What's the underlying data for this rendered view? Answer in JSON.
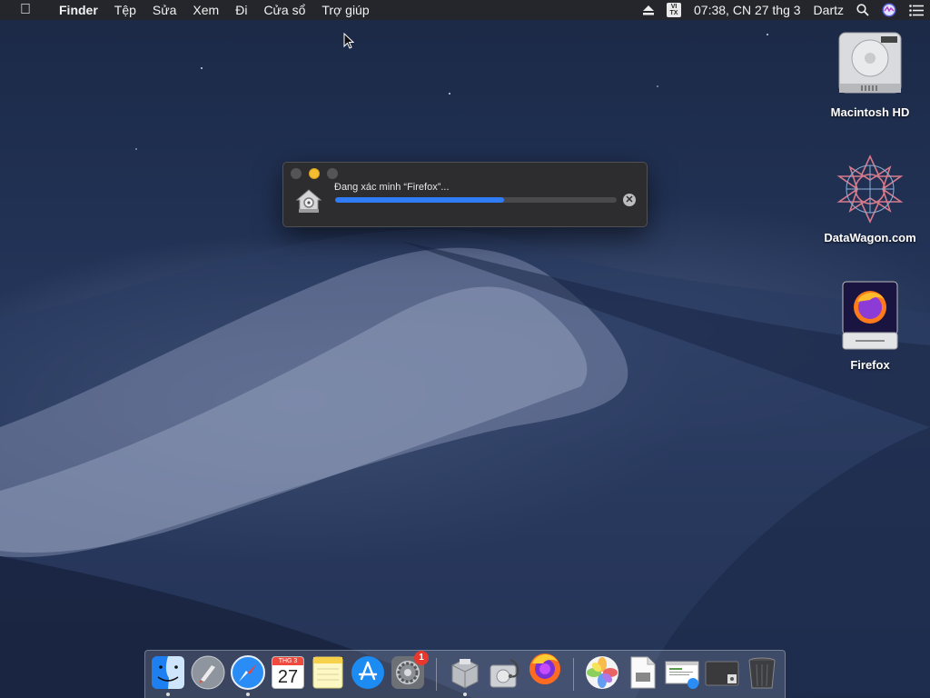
{
  "menubar": {
    "app_name": "Finder",
    "menus": [
      "Tệp",
      "Sửa",
      "Xem",
      "Đi",
      "Cửa sổ",
      "Trợ giúp"
    ],
    "input_source": "VI\nTX",
    "clock": "07:38, CN 27 thg 3",
    "user": "Dartz"
  },
  "desktop": {
    "icons": [
      {
        "label": "Macintosh HD",
        "icon": "hard-drive-icon"
      },
      {
        "label": "DataWagon.com",
        "icon": "datawagon-logo-icon"
      },
      {
        "label": "Firefox",
        "icon": "firefox-disk-image-icon"
      }
    ]
  },
  "dialog": {
    "message": "Đang xác minh “Firefox”...",
    "progress": 0.6,
    "stop_label": "✕"
  },
  "dock": {
    "calendar_month": "THG 3",
    "calendar_day": "27",
    "system_prefs_badge": "1",
    "items": [
      "Finder",
      "Launchpad",
      "Safari",
      "Lịch",
      "Ghi chú",
      "App Store",
      "Tùy chọn Hệ thống",
      "Trình cài đặt",
      "Tiện ích Ổ đĩa",
      "Firefox",
      "Ảnh",
      "Xem trước",
      "Tài liệu",
      "Ảnh chụp màn hình",
      "Thùng rác"
    ]
  },
  "colors": {
    "progress_fill": "#2f7cf6",
    "minimize_button": "#f5bd30",
    "badge": "#e8372c"
  }
}
